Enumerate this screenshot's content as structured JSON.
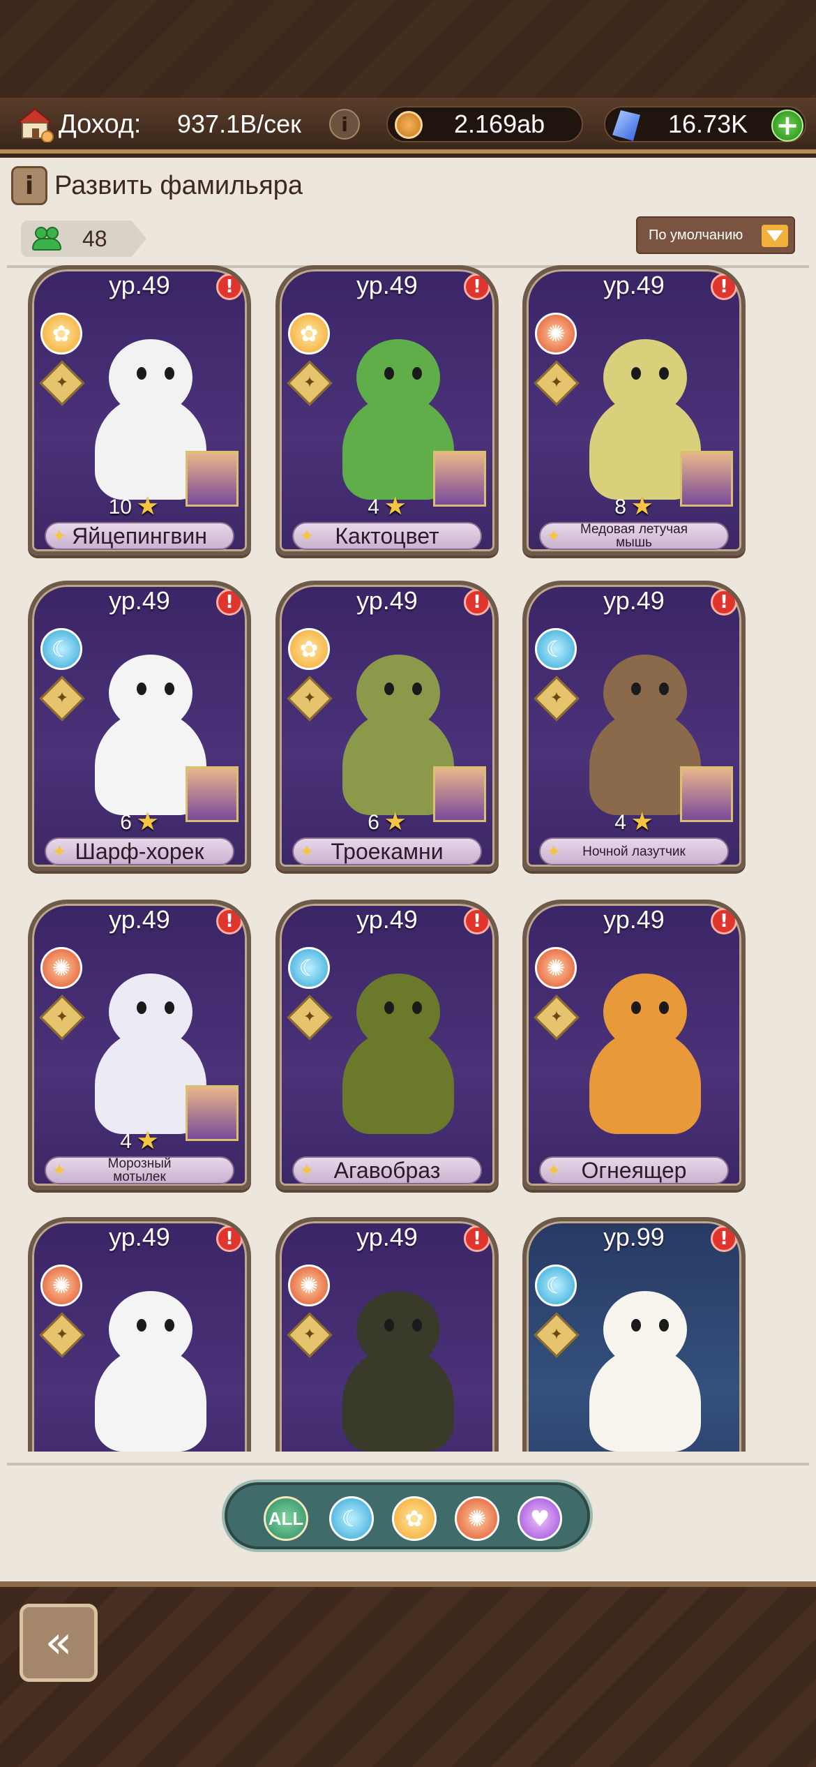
{
  "resources": {
    "income_label": "Доход:",
    "income_value": "937.1B/сек",
    "coins": "2.169ab",
    "gems": "16.73K"
  },
  "panel": {
    "title": "Развить фамильяра",
    "count": "48",
    "sort_label": "По умолчанию"
  },
  "cards": [
    {
      "level": "ур.49",
      "stars": "10",
      "name": "Яйцепингвин",
      "element": "flower",
      "color": "#f2f2f2"
    },
    {
      "level": "ур.49",
      "stars": "4",
      "name": "Кактоцвет",
      "element": "flower",
      "color": "#5fae4a"
    },
    {
      "level": "ур.49",
      "stars": "8",
      "name": "Медовая летучая мышь",
      "element": "sun",
      "color": "#d8d07a"
    },
    {
      "level": "ур.49",
      "stars": "6",
      "name": "Шарф-хорек",
      "element": "moon",
      "color": "#f4f4f4"
    },
    {
      "level": "ур.49",
      "stars": "6",
      "name": "Троекамни",
      "element": "flower",
      "color": "#8a9a4a"
    },
    {
      "level": "ур.49",
      "stars": "4",
      "name": "Ночной лазутчик",
      "element": "moon",
      "color": "#8a6a4a"
    },
    {
      "level": "ур.49",
      "stars": "4",
      "name": "Морозный мотылек",
      "element": "sun",
      "color": "#eceaf4"
    },
    {
      "level": "ур.49",
      "stars": "",
      "name": "Агавобраз",
      "element": "moon",
      "color": "#6a7a2a"
    },
    {
      "level": "ур.49",
      "stars": "",
      "name": "Огнеящер",
      "element": "sun",
      "color": "#e89a3a"
    },
    {
      "level": "ур.49",
      "stars": "",
      "name": "",
      "element": "sun",
      "color": "#f4f4f4"
    },
    {
      "level": "ур.49",
      "stars": "",
      "name": "",
      "element": "sun",
      "color": "#3a3a2a"
    },
    {
      "level": "ур.99",
      "stars": "",
      "name": "",
      "element": "moon",
      "color": "#f8f4ee"
    }
  ],
  "filters": {
    "all_label": "ALL",
    "icons": [
      "moon-icon",
      "flower-icon",
      "sun-icon",
      "heart-icon"
    ]
  }
}
